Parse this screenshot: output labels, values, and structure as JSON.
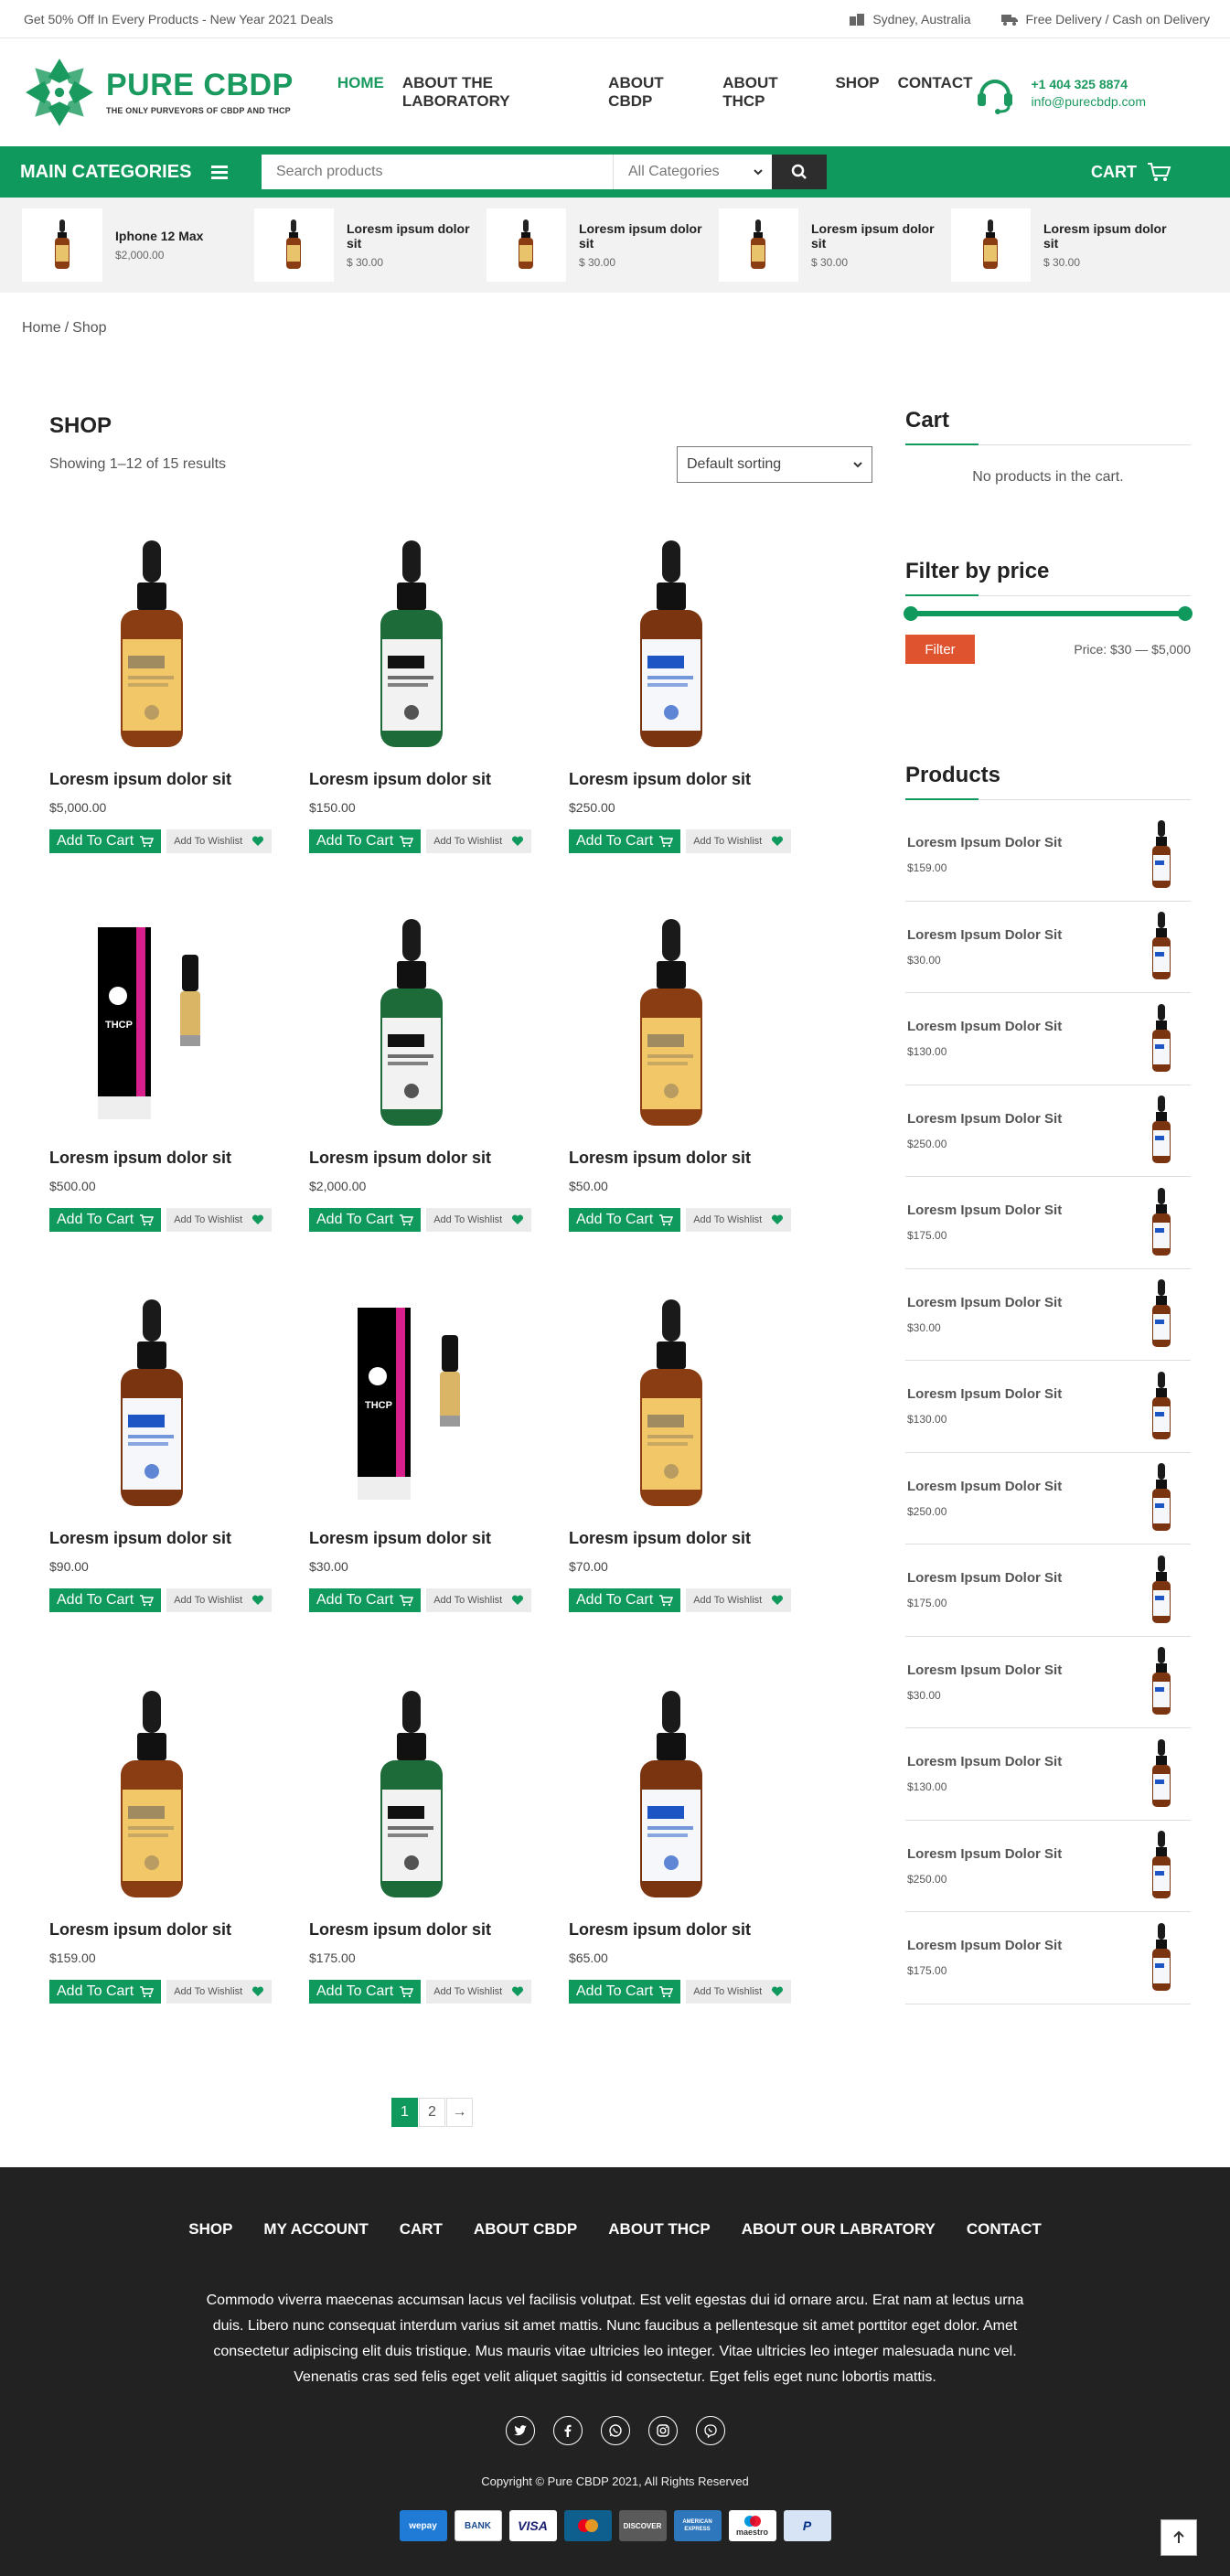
{
  "topbar": {
    "promo": "Get 50% Off In Every Products - New Year 2021 Deals",
    "location": "Sydney, Australia",
    "delivery": "Free Delivery / Cash on Delivery"
  },
  "brand": {
    "name": "PURE CBDP",
    "tagline": "THE ONLY PURVEYORS OF CBDP AND THCP"
  },
  "nav": [
    {
      "label": "HOME",
      "active": true
    },
    {
      "label": "ABOUT THE LABORATORY",
      "active": false
    },
    {
      "label": "ABOUT CBDP",
      "active": false
    },
    {
      "label": "ABOUT THCP",
      "active": false
    },
    {
      "label": "SHOP",
      "active": false
    },
    {
      "label": "CONTACT",
      "active": false
    }
  ],
  "contact": {
    "phone": "+1 404 325 8874",
    "email": "info@purecbdp.com"
  },
  "greenbar": {
    "categories_label": "MAIN CATEGORIES",
    "search_placeholder": "Search products",
    "category_select": "All Categories",
    "cart_label": "CART"
  },
  "featured": [
    {
      "title": "Iphone 12 Max",
      "price": "$2,000.00"
    },
    {
      "title": "Loresm ipsum dolor sit",
      "price": "$ 30.00"
    },
    {
      "title": "Loresm ipsum dolor sit",
      "price": "$ 30.00"
    },
    {
      "title": "Loresm ipsum dolor sit",
      "price": "$ 30.00"
    },
    {
      "title": "Loresm ipsum dolor sit",
      "price": "$ 30.00"
    }
  ],
  "breadcrumb": {
    "home": "Home",
    "sep": "/",
    "current": "Shop"
  },
  "shop": {
    "title": "SHOP",
    "result_count": "Showing 1–12 of 15 results",
    "sorting": "Default sorting",
    "add_to_cart": "Add To Cart",
    "add_to_wishlist": "Add To Wishlist"
  },
  "products": [
    {
      "title": "Loresm ipsum dolor sit",
      "price": "$5,000.00",
      "img": "amber"
    },
    {
      "title": "Loresm ipsum dolor sit",
      "price": "$150.00",
      "img": "green"
    },
    {
      "title": "Loresm ipsum dolor sit",
      "price": "$250.00",
      "img": "blue"
    },
    {
      "title": "Loresm ipsum dolor sit",
      "price": "$500.00",
      "img": "cart"
    },
    {
      "title": "Loresm ipsum dolor sit",
      "price": "$2,000.00",
      "img": "green"
    },
    {
      "title": "Loresm ipsum dolor sit",
      "price": "$50.00",
      "img": "amber"
    },
    {
      "title": "Loresm ipsum dolor sit",
      "price": "$90.00",
      "img": "blue"
    },
    {
      "title": "Loresm ipsum dolor sit",
      "price": "$30.00",
      "img": "cart"
    },
    {
      "title": "Loresm ipsum dolor sit",
      "price": "$70.00",
      "img": "amber"
    },
    {
      "title": "Loresm ipsum dolor sit",
      "price": "$159.00",
      "img": "amber"
    },
    {
      "title": "Loresm ipsum dolor sit",
      "price": "$175.00",
      "img": "green"
    },
    {
      "title": "Loresm ipsum dolor sit",
      "price": "$65.00",
      "img": "blue"
    }
  ],
  "pagination": {
    "pages": [
      "1",
      "2"
    ],
    "next": "→"
  },
  "sidebar": {
    "cart_title": "Cart",
    "cart_empty": "No products in the cart.",
    "filter_title": "Filter by price",
    "filter_button": "Filter",
    "price_range": "Price: $30 — $5,000",
    "products_title": "Products",
    "products": [
      {
        "title": "Loresm Ipsum Dolor Sit",
        "price": "$159.00"
      },
      {
        "title": "Loresm Ipsum Dolor Sit",
        "price": "$30.00"
      },
      {
        "title": "Loresm Ipsum Dolor Sit",
        "price": "$130.00"
      },
      {
        "title": "Loresm Ipsum Dolor Sit",
        "price": "$250.00"
      },
      {
        "title": "Loresm Ipsum Dolor Sit",
        "price": "$175.00"
      },
      {
        "title": "Loresm Ipsum Dolor Sit",
        "price": "$30.00"
      },
      {
        "title": "Loresm Ipsum Dolor Sit",
        "price": "$130.00"
      },
      {
        "title": "Loresm Ipsum Dolor Sit",
        "price": "$250.00"
      },
      {
        "title": "Loresm Ipsum Dolor Sit",
        "price": "$175.00"
      },
      {
        "title": "Loresm Ipsum Dolor Sit",
        "price": "$30.00"
      },
      {
        "title": "Loresm Ipsum Dolor Sit",
        "price": "$130.00"
      },
      {
        "title": "Loresm Ipsum Dolor Sit",
        "price": "$250.00"
      },
      {
        "title": "Loresm Ipsum Dolor Sit",
        "price": "$175.00"
      }
    ]
  },
  "footer": {
    "nav": [
      "SHOP",
      "MY ACCOUNT",
      "CART",
      "ABOUT CBDP",
      "ABOUT THCP",
      "ABOUT OUR LABRATORY",
      "CONTACT"
    ],
    "description": "Commodo viverra maecenas accumsan lacus vel facilisis volutpat. Est velit egestas dui id ornare arcu. Erat nam at lectus urna duis. Libero nunc consequat interdum varius sit amet mattis. Nunc faucibus a pellentesque sit amet porttitor eget dolor. Amet consectetur adipiscing elit duis tristique. Mus mauris vitae ultricies leo integer. Vitae ultricies leo integer malesuada nunc vel. Venenatis cras sed felis eget velit aliquet sagittis id consectetur. Eget felis eget nunc lobortis mattis.",
    "socials": [
      "twitter-icon",
      "facebook-icon",
      "whatsapp-icon",
      "instagram-icon",
      "viber-icon"
    ],
    "copyright": "Copyright © Pure CBDP 2021, All Rights Reserved",
    "payments": [
      "wepay",
      "BANK",
      "VISA",
      "mastercard",
      "DISCOVER",
      "AMERICAN EXPRESS",
      "maestro",
      "PayPal"
    ]
  },
  "colors": {
    "brand_green": "#10995c",
    "filter_orange": "#e0532f",
    "footer_bg": "#222222"
  }
}
